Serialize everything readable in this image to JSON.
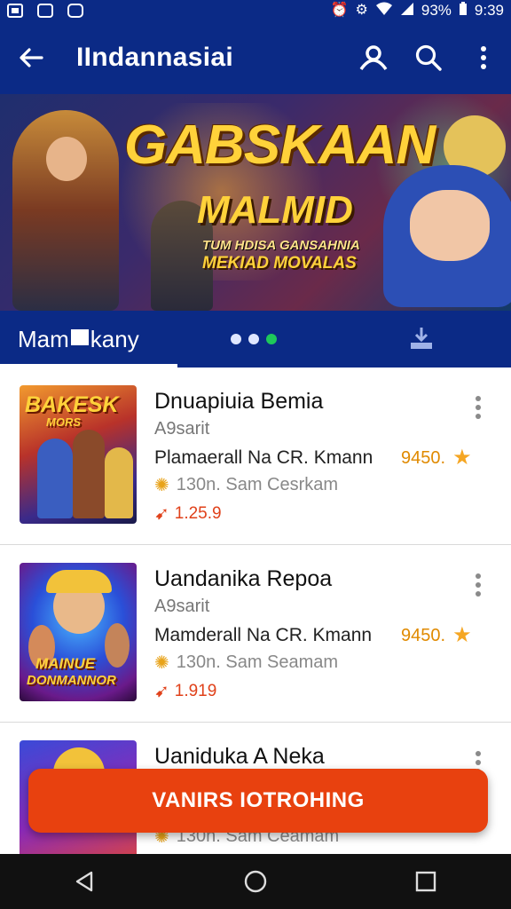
{
  "status_bar": {
    "left_icons": [
      "gallery-icon",
      "photo-icon",
      "app-icon"
    ],
    "battery": "93%",
    "time": "9:39"
  },
  "app_bar": {
    "title": "IIndannasiai",
    "back_icon": "arrow-left-icon",
    "actions": [
      "account-icon",
      "search-icon",
      "more-vert-icon"
    ]
  },
  "banner": {
    "title_line1": "GABSKAAN",
    "title_line2": "MALMID",
    "subtitle_line1": "TUM HDISA GANSAHNIA",
    "subtitle_line2": "MEKIAD MOVALAS"
  },
  "tabs": {
    "active_label_part1": "Mam",
    "active_label_part2": "kany",
    "carousel_dots": 3,
    "carousel_active_index": 2,
    "right_icon": "download-icon"
  },
  "games": [
    {
      "name": "Dnuapiuia Bemia",
      "developer": "A9sarit",
      "description": "Plamaerall Na CR. Kmann",
      "rating": "9450.",
      "meta": "130n. Sam Cesrkam",
      "price": "1.25.9",
      "thumb_text": "BAKESK",
      "thumb_subtext": "MORS"
    },
    {
      "name": "Uandanika Repoa",
      "developer": "A9sarit",
      "description": "Mamderall Na CR. Kmann",
      "rating": "9450.",
      "meta": "130n. Sam Seamam",
      "price": "1.919",
      "thumb_text": "MAINUE",
      "thumb_subtext": "DONMANNOR"
    },
    {
      "name": "Uaniduka A Neka",
      "developer": "",
      "description": "",
      "rating": "",
      "meta": "130n. Sam Ceamam",
      "price": "",
      "thumb_text": "",
      "thumb_subtext": ""
    }
  ],
  "cta": {
    "label": "VANIRS IOTROHING"
  },
  "nav_bar": [
    "back-triangle-icon",
    "home-circle-icon",
    "recents-square-icon"
  ],
  "colors": {
    "primary": "#0b2a86",
    "accent": "#e8410f",
    "carousel_active": "#1ec85a",
    "rating": "#e08a00",
    "star": "#f5a623"
  }
}
